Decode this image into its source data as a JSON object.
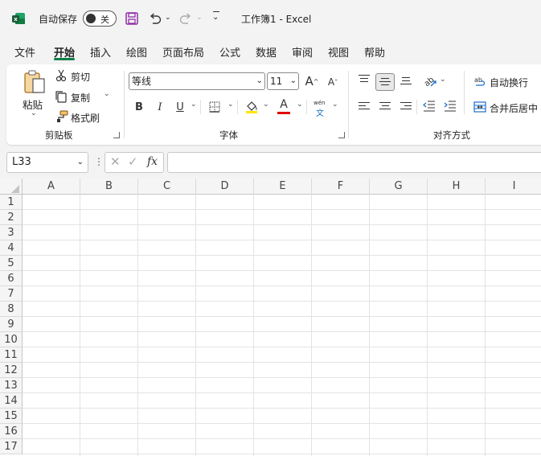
{
  "titlebar": {
    "autosave_label": "自动保存",
    "autosave_state": "关",
    "doc_title": "工作簿1  -  Excel"
  },
  "tabs": [
    "文件",
    "开始",
    "插入",
    "绘图",
    "页面布局",
    "公式",
    "数据",
    "审阅",
    "视图",
    "帮助"
  ],
  "active_tab": "开始",
  "clipboard": {
    "paste": "粘贴",
    "cut": "剪切",
    "copy": "复制",
    "format_painter": "格式刷",
    "label": "剪贴板"
  },
  "font": {
    "name": "等线",
    "size": "11",
    "grow": "A",
    "shrink": "A",
    "bold": "B",
    "italic": "I",
    "underline": "U",
    "font_color_letter": "A",
    "phonetic_top": "wén",
    "phonetic_bottom": "文",
    "label": "字体",
    "highlight_color": "#ffe600",
    "font_color": "#e00000"
  },
  "alignment": {
    "wrap_text": "自动换行",
    "merge_center": "合并后居中",
    "label": "对齐方式"
  },
  "formula_bar": {
    "name_box": "L33",
    "fx": "fx"
  },
  "grid": {
    "columns": [
      "A",
      "B",
      "C",
      "D",
      "E",
      "F",
      "G",
      "H",
      "I"
    ],
    "rows": [
      "1",
      "2",
      "3",
      "4",
      "5",
      "6",
      "7",
      "8",
      "9",
      "10",
      "11",
      "12",
      "13",
      "14",
      "15",
      "16",
      "17"
    ]
  },
  "colors": {
    "accent": "#117f4b",
    "ribbon_bg": "#ffffff",
    "app_bg": "#f3f3f3"
  }
}
